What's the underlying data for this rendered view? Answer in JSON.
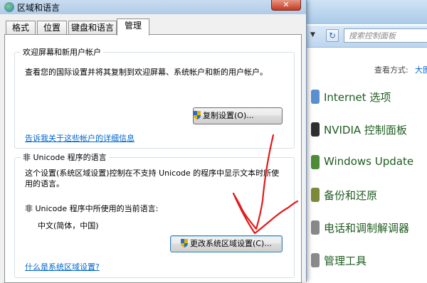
{
  "dialog": {
    "title": "区域和语言",
    "close_label": "✕",
    "tabs": [
      {
        "label": "格式"
      },
      {
        "label": "位置"
      },
      {
        "label": "键盘和语言"
      },
      {
        "label": "管理",
        "active": true
      }
    ],
    "welcome": {
      "group_title": "欢迎屏幕和新用户帐户",
      "description": "查看您的国际设置并将其复制到欢迎屏幕、系统帐户和新的用户帐户。",
      "copy_button": "复制设置(O)...",
      "link": "告诉我关于这些帐户的详细信息"
    },
    "non_unicode": {
      "group_title": "非 Unicode 程序的语言",
      "description_line1": "这个设置(系统区域设置)控制在不支持 Unicode 的程序中显示文本时所使",
      "description_line2": "用的语言。",
      "current_label": "非 Unicode 程序中所使用的当前语言:",
      "current_value": "中文(简体，中国)",
      "change_button": "更改系统区域设置(C)...",
      "link": "什么是系统区域设置?"
    }
  },
  "control_panel": {
    "search_placeholder": "搜索控制面板",
    "view_by_label": "查看方式:",
    "view_by_value": "大图",
    "items": [
      {
        "label": "Internet 选项",
        "icon": "globe-icon",
        "color": "#5a8fd0"
      },
      {
        "label": "NVIDIA 控制面板",
        "icon": "nvidia-icon",
        "color": "#2f2f2f"
      },
      {
        "label": "Windows Update",
        "icon": "windows-update-icon",
        "color": "#4d8a3a"
      },
      {
        "label": "备份和还原",
        "icon": "backup-icon",
        "color": "#7a8a3a"
      },
      {
        "label": "电话和调制解调器",
        "icon": "phone-icon",
        "color": "#888888"
      },
      {
        "label": "管理工具",
        "icon": "tools-icon",
        "color": "#8a8a8a"
      }
    ]
  },
  "colors": {
    "annotation": "#e11b1b",
    "link": "#0066cc",
    "cp_label": "#1e5c1e"
  }
}
